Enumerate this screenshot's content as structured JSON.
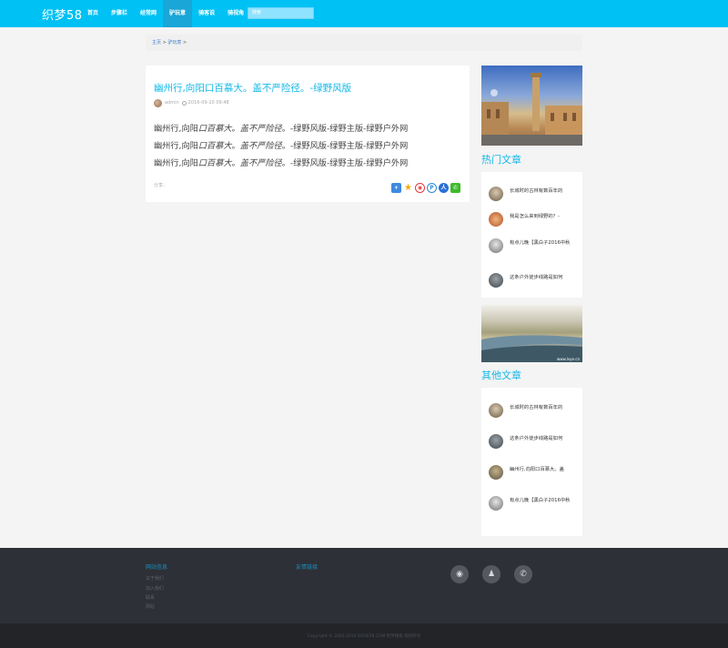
{
  "header": {
    "logo": "织梦58",
    "nav": [
      "首页",
      "步骤栏",
      "经常网",
      "驴玩意",
      "骑客说",
      "骑视角"
    ],
    "active_index": 3,
    "search_placeholder": "搜索"
  },
  "breadcrumb": {
    "home": "主页",
    "sep1": " > ",
    "section": "驴玩意",
    "sep2": " >"
  },
  "article": {
    "title": "幽州行,向阳口百慕大。盖不严险径。-绿野风版",
    "author": "admin",
    "date": "2016-09-10 09:48",
    "lines": [
      {
        "a": "幽州行,向阳",
        "b": "口百慕大",
        "c": "。",
        "d": "盖不严险径",
        "e": "。-绿野风版-绿野主版-绿野户外网"
      },
      {
        "a": "幽州行,向阳",
        "b": "口百慕大",
        "c": "。",
        "d": "盖不严险径",
        "e": "。-绿野风版-绿野主版-绿野户外网"
      },
      {
        "a": "幽州行,向阳",
        "b": "口百慕大",
        "c": "。",
        "d": "盖不严险径",
        "e": "。-绿野风版-绿野主版-绿野户外网"
      }
    ],
    "share_label": "分享：",
    "share_icons": [
      "plus-share-icon",
      "star-share-icon",
      "weibo-share-icon",
      "pinterest-share-icon",
      "renren-share-icon",
      "wechat-share-icon"
    ]
  },
  "sidebar": {
    "hot_title": "热门文章",
    "hot": [
      {
        "text": "长城时的古林有数百年的"
      },
      {
        "text": "我是怎么来到绿野的？-"
      },
      {
        "text": "有点儿晚【黑白子2016中秋"
      },
      {
        "text": "这条户外徒步线路是如何"
      }
    ],
    "other_title": "其他文章",
    "other": [
      {
        "text": "长城时的古林有数百年的"
      },
      {
        "text": "这条户外徒步线路是如何"
      },
      {
        "text": "幽州行,向阳口百慕大。盖"
      },
      {
        "text": "有点儿晚【黑白子2016中秋"
      }
    ],
    "image2_caption": "www.lvye.cn"
  },
  "footer": {
    "col1_title": "网站信息",
    "col1_links": [
      "关于我们",
      "加入我们",
      "联系",
      "网站"
    ],
    "col2_title": "友情链接",
    "social": [
      "weibo-icon",
      "qq-icon",
      "wechat-icon"
    ],
    "copyright": "Copyright © 2002-2016 DEDE58.COM 织梦模板 版权所有"
  },
  "colors": {
    "header": "#00c1f4",
    "accent": "#13b8e8",
    "footer": "#2d3036"
  }
}
